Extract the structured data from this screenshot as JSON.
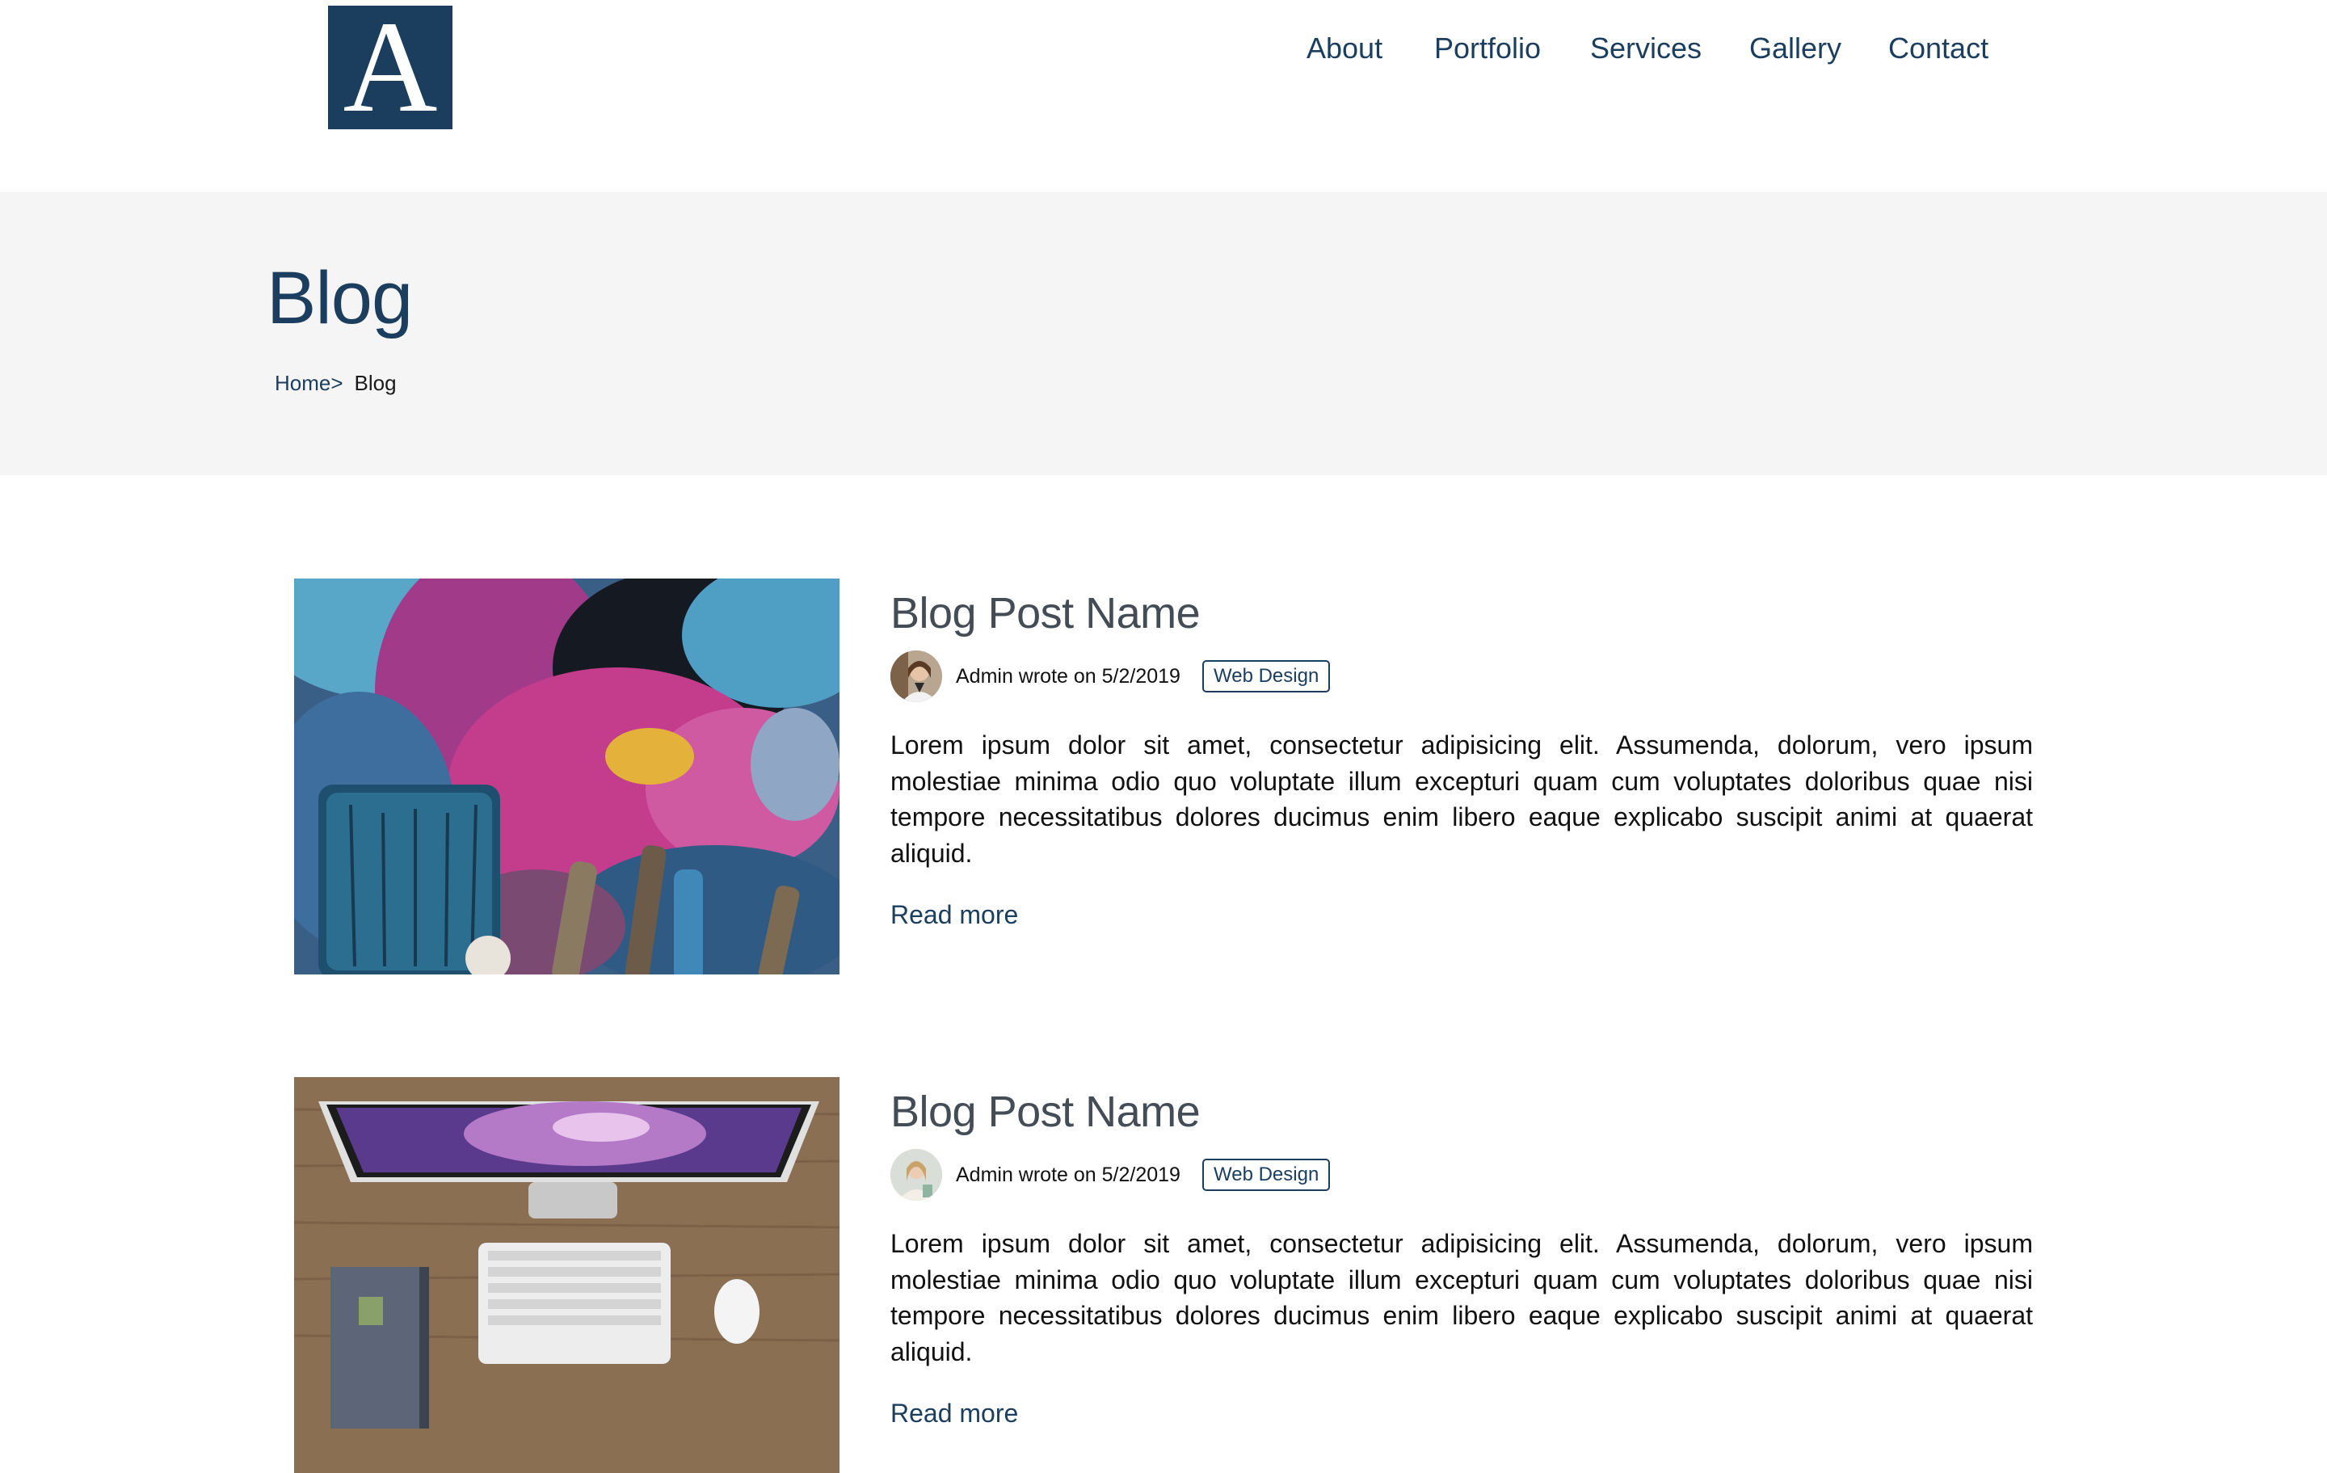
{
  "brand": {
    "logo_letter": "A",
    "color": "#1b3d5e"
  },
  "nav": {
    "items": [
      {
        "label": "About"
      },
      {
        "label": "Portfolio"
      },
      {
        "label": "Services"
      },
      {
        "label": "Gallery"
      },
      {
        "label": "Contact"
      }
    ]
  },
  "banner": {
    "title": "Blog",
    "breadcrumb": {
      "home": "Home",
      "separator": ">",
      "current": "Blog"
    }
  },
  "posts": [
    {
      "title": "Blog Post Name",
      "image": "paint-palette-photo",
      "author_line": "Admin wrote on 5/2/2019",
      "tag": "Web Design",
      "excerpt": "Lorem ipsum dolor sit amet, consectetur adipisicing elit. Assumenda, dolorum, vero ipsum molestiae minima odio quo voluptate illum excepturi quam cum voluptates doloribus quae nisi tempore necessitatibus dolores ducimus enim libero eaque explicabo suscipit animi at quaerat aliquid.",
      "read_more": "Read more"
    },
    {
      "title": "Blog Post Name",
      "image": "desk-computer-photo",
      "author_line": "Admin wrote on 5/2/2019",
      "tag": "Web Design",
      "excerpt": "Lorem ipsum dolor sit amet, consectetur adipisicing elit. Assumenda, dolorum, vero ipsum molestiae minima odio quo voluptate illum excepturi quam cum voluptates doloribus quae nisi tempore necessitatibus dolores ducimus enim libero eaque explicabo suscipit animi at quaerat aliquid.",
      "read_more": "Read more"
    }
  ]
}
